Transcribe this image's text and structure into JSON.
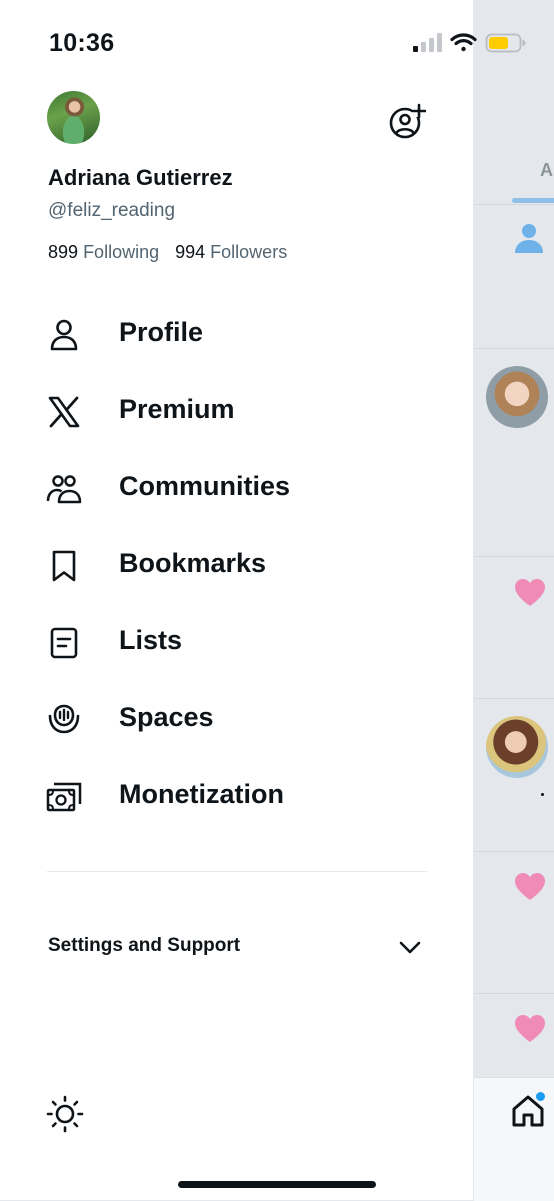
{
  "status_bar": {
    "time": "10:36",
    "battery_color": "#ffcc00"
  },
  "profile": {
    "name": "Adriana Gutierrez",
    "handle": "@feliz_reading",
    "following_count": "899",
    "following_label": "Following",
    "followers_count": "994",
    "followers_label": "Followers"
  },
  "menu": [
    {
      "label": "Profile",
      "icon": "person-icon"
    },
    {
      "label": "Premium",
      "icon": "x-logo-icon"
    },
    {
      "label": "Communities",
      "icon": "communities-icon"
    },
    {
      "label": "Bookmarks",
      "icon": "bookmark-icon"
    },
    {
      "label": "Lists",
      "icon": "lists-icon"
    },
    {
      "label": "Spaces",
      "icon": "spaces-icon"
    },
    {
      "label": "Monetization",
      "icon": "monetization-icon"
    }
  ],
  "settings_section": {
    "label": "Settings and Support",
    "expanded": false
  },
  "background": {
    "tab_label": "A"
  },
  "colors": {
    "accent": "#1d9bf0",
    "heart": "#f08bb8",
    "text_primary": "#0f1419",
    "text_secondary": "#536471"
  }
}
